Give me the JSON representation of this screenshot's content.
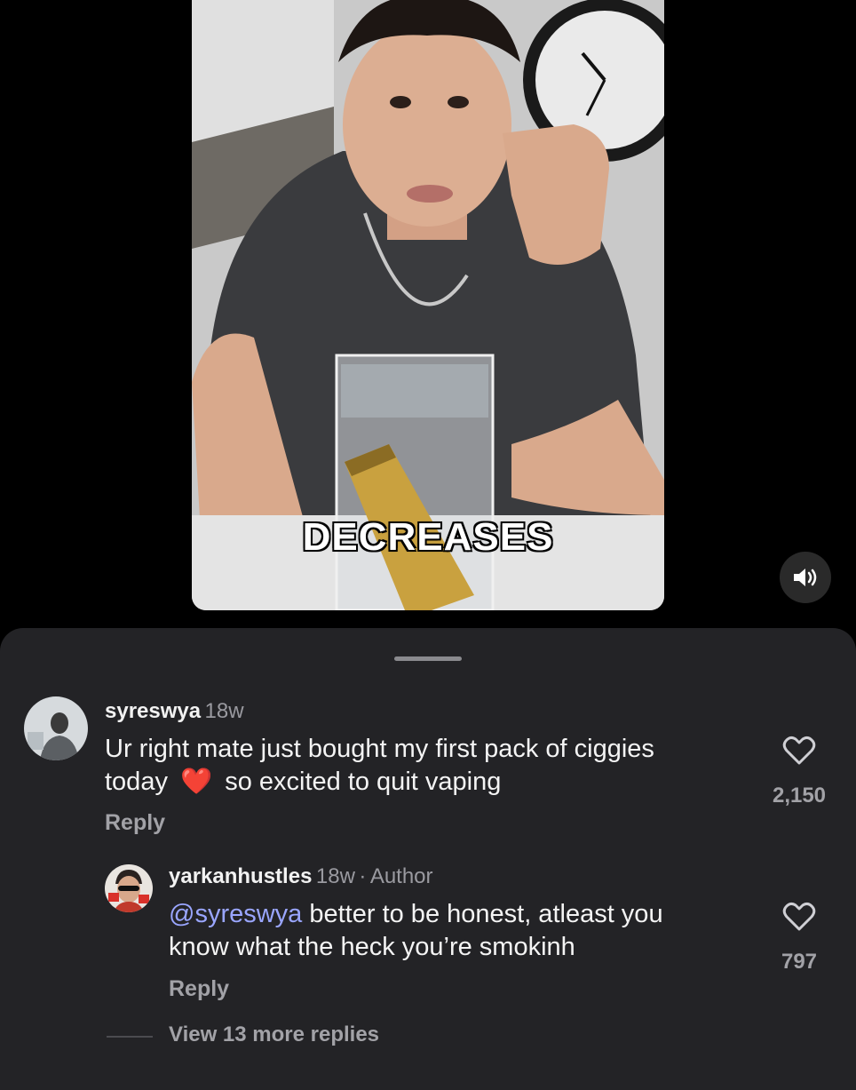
{
  "video": {
    "caption": "DECREASES"
  },
  "comments": [
    {
      "username": "syreswya",
      "age": "18w",
      "text_line1": "Ur right mate just bought my first pack of ciggies",
      "text_line2_a": "today",
      "emoji": "❤️",
      "text_line2_b": "so excited to quit vaping",
      "reply_label": "Reply",
      "likes": "2,150"
    },
    {
      "username": "yarkanhustles",
      "age": "18w",
      "separator": "·",
      "badge": "Author",
      "mention": "@syreswya",
      "text_line1": " better to be honest, atleast you",
      "text_line2": "know what the heck you’re smokinh",
      "reply_label": "Reply",
      "likes": "797"
    }
  ],
  "view_more": "View 13 more replies",
  "colors": {
    "sheet_bg": "#232326",
    "mention": "#9aa6ff",
    "muted": "#a2a2a7"
  }
}
